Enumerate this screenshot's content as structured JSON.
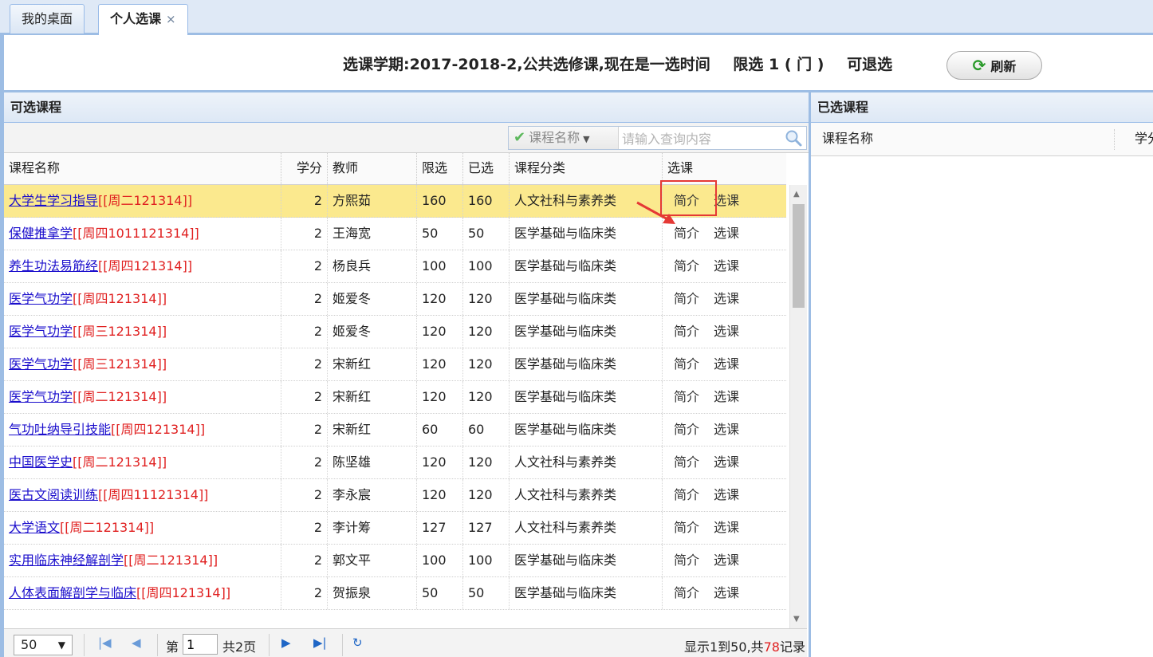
{
  "tabs": [
    {
      "label": "我的桌面"
    },
    {
      "label": "个人选课",
      "close": "×"
    }
  ],
  "info": {
    "term": "选课学期:2017-2018-2,公共选修课,现在是一选时间",
    "limit": "限选 1 ( 门 )",
    "withdraw": "可退选",
    "refresh_label": "刷新"
  },
  "available": {
    "title": "可选课程",
    "search": {
      "field": "课程名称",
      "placeholder": "请输入查询内容"
    },
    "columns": [
      "课程名称",
      "学分",
      "教师",
      "限选",
      "已选",
      "课程分类",
      "选课"
    ],
    "rows": [
      {
        "name": "大学生学习指导",
        "time": "[[周二121314]]",
        "credit": "2",
        "teacher": "方熙茹",
        "limit": "160",
        "selected": "160",
        "category": "人文社科与素养类",
        "intro": "简介",
        "choose": "选课"
      },
      {
        "name": "保健推拿学",
        "time": "[[周四1011121314]]",
        "credit": "2",
        "teacher": "王海宽",
        "limit": "50",
        "selected": "50",
        "category": "医学基础与临床类",
        "intro": "简介",
        "choose": "选课"
      },
      {
        "name": "养生功法易筋经",
        "time": "[[周四121314]]",
        "credit": "2",
        "teacher": "杨良兵",
        "limit": "100",
        "selected": "100",
        "category": "医学基础与临床类",
        "intro": "简介",
        "choose": "选课"
      },
      {
        "name": "医学气功学",
        "time": "[[周四121314]]",
        "credit": "2",
        "teacher": "姬爱冬",
        "limit": "120",
        "selected": "120",
        "category": "医学基础与临床类",
        "intro": "简介",
        "choose": "选课"
      },
      {
        "name": "医学气功学",
        "time": "[[周三121314]]",
        "credit": "2",
        "teacher": "姬爱冬",
        "limit": "120",
        "selected": "120",
        "category": "医学基础与临床类",
        "intro": "简介",
        "choose": "选课"
      },
      {
        "name": "医学气功学",
        "time": "[[周三121314]]",
        "credit": "2",
        "teacher": "宋新红",
        "limit": "120",
        "selected": "120",
        "category": "医学基础与临床类",
        "intro": "简介",
        "choose": "选课"
      },
      {
        "name": "医学气功学",
        "time": "[[周二121314]]",
        "credit": "2",
        "teacher": "宋新红",
        "limit": "120",
        "selected": "120",
        "category": "医学基础与临床类",
        "intro": "简介",
        "choose": "选课"
      },
      {
        "name": "气功吐纳导引技能",
        "time": "[[周四121314]]",
        "credit": "2",
        "teacher": "宋新红",
        "limit": "60",
        "selected": "60",
        "category": "医学基础与临床类",
        "intro": "简介",
        "choose": "选课"
      },
      {
        "name": "中国医学史",
        "time": "[[周二121314]]",
        "credit": "2",
        "teacher": "陈坚雄",
        "limit": "120",
        "selected": "120",
        "category": "人文社科与素养类",
        "intro": "简介",
        "choose": "选课"
      },
      {
        "name": "医古文阅读训练",
        "time": "[[周四11121314]]",
        "credit": "2",
        "teacher": "李永宸",
        "limit": "120",
        "selected": "120",
        "category": "人文社科与素养类",
        "intro": "简介",
        "choose": "选课"
      },
      {
        "name": "大学语文",
        "time": "[[周二121314]]",
        "credit": "2",
        "teacher": "李计筹",
        "limit": "127",
        "selected": "127",
        "category": "人文社科与素养类",
        "intro": "简介",
        "choose": "选课"
      },
      {
        "name": "实用临床神经解剖学",
        "time": "[[周二121314]]",
        "credit": "2",
        "teacher": "郭文平",
        "limit": "100",
        "selected": "100",
        "category": "医学基础与临床类",
        "intro": "简介",
        "choose": "选课"
      },
      {
        "name": "人体表面解剖学与临床",
        "time": "[[周四121314]]",
        "credit": "2",
        "teacher": "贺振泉",
        "limit": "50",
        "selected": "50",
        "category": "医学基础与临床类",
        "intro": "简介",
        "choose": "选课"
      }
    ],
    "pager": {
      "page_size": "50",
      "page_prefix": "第",
      "page_value": "1",
      "page_total": "共2页",
      "info_prefix": "显示1到50,共",
      "info_count": "78",
      "info_suffix": "记录"
    }
  },
  "chosen": {
    "title": "已选课程",
    "columns": [
      "课程名称",
      "学分"
    ]
  }
}
